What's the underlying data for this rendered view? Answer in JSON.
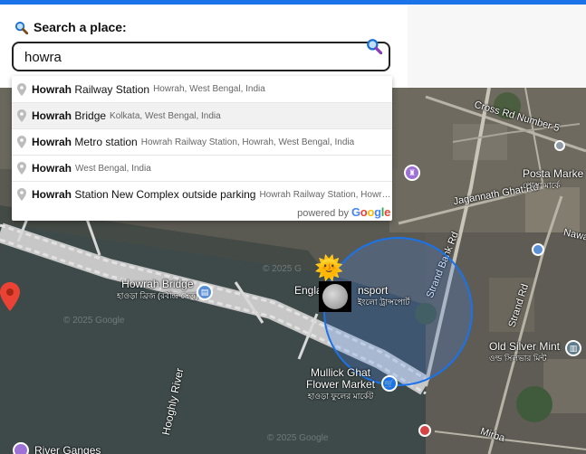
{
  "search": {
    "label": "Search a place:",
    "value": "howra",
    "label_icon": "search-icon",
    "go_icon": "search-icon"
  },
  "autocomplete": {
    "items": [
      {
        "match": "Howrah",
        "rest": " Railway Station",
        "secondary": "Howrah, West Bengal, India"
      },
      {
        "match": "Howrah",
        "rest": " Bridge",
        "secondary": "Kolkata, West Bengal, India"
      },
      {
        "match": "Howrah",
        "rest": " Metro station",
        "secondary": "Howrah Railway Station, Howrah, West Bengal, India"
      },
      {
        "match": "Howrah",
        "rest": "",
        "secondary": "West Bengal, India"
      },
      {
        "match": "Howrah",
        "rest": " Station New Complex outside parking",
        "secondary": "Howrah Railway Station, Howra…"
      }
    ],
    "powered_by": "powered by",
    "google": "Google"
  },
  "map": {
    "roads": {
      "cross_rd": "Cross Rd Number 5",
      "jagannath": "Jagannath Ghat Rd",
      "strand_bank": "Strand Bank Rd",
      "strand_rd": "Strand Rd",
      "nawab": "Nawa",
      "hooghly": "Hooghly River",
      "mirbahar": "Mirba"
    },
    "places": {
      "posta_market": "Posta Marke",
      "posta_market_bn": "পোস্তা মার্কে",
      "howrah_bridge": "Howrah Bridge",
      "howrah_bridge_bn": "হাওড়া ব্রিজ (রবীন্দ্র সেতু)",
      "engla": "Engla",
      "transport": "nsport",
      "transport_bn": "ইংলো ট্রান্সপোর্ট",
      "old_silver_mint": "Old Silver Mint",
      "old_silver_mint_bn": "ওল্ড সিলভার মিন্ট",
      "mullick_ghat": "Mullick Ghat",
      "flower_market": "Flower Market",
      "flower_market_bn": "হাওড়া ফুলের মার্কেট",
      "river_ganges": "River Ganges"
    },
    "watermarks": [
      "© 2025 G",
      "© 2025 Google",
      "© 2025 Google"
    ]
  },
  "colors": {
    "accent": "#1a73e8",
    "radius_fill": "#4285f4",
    "pin": "#ea4335"
  }
}
